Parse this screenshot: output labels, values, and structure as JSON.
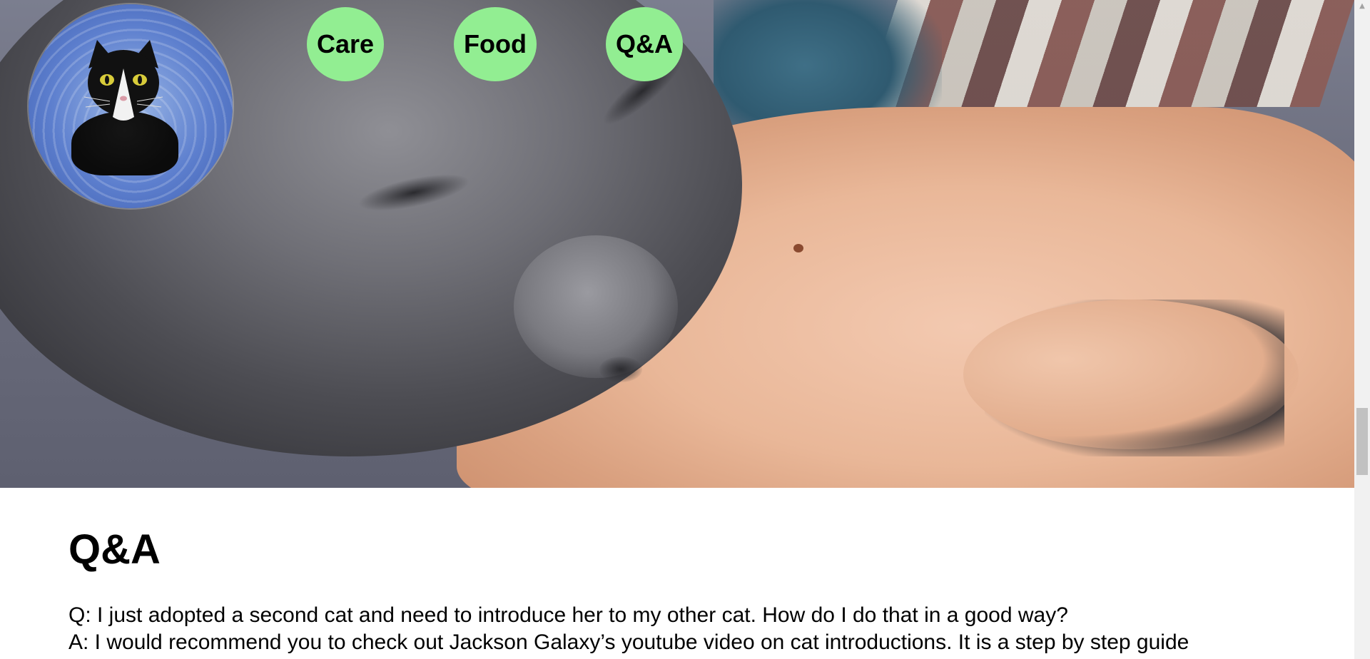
{
  "nav": {
    "care": "Care",
    "food": "Food",
    "qa": "Q&A"
  },
  "logo": {
    "icon": "cat-with-cone-logo"
  },
  "hero": {
    "icon": "cat-on-arm-photo"
  },
  "page": {
    "title": "Q&A"
  },
  "qa": {
    "question": "Q: I just adopted a second cat and need to introduce her to my other cat. How do I do that in a good way?",
    "answer": "A: I would recommend you to check out Jackson Galaxy’s youtube video on cat introductions. It is a step by step guide"
  },
  "colors": {
    "nav_button": "#92ee92",
    "text": "#000000",
    "scrollbar_track": "#f1f1f1",
    "scrollbar_thumb": "#c1c1c1"
  }
}
